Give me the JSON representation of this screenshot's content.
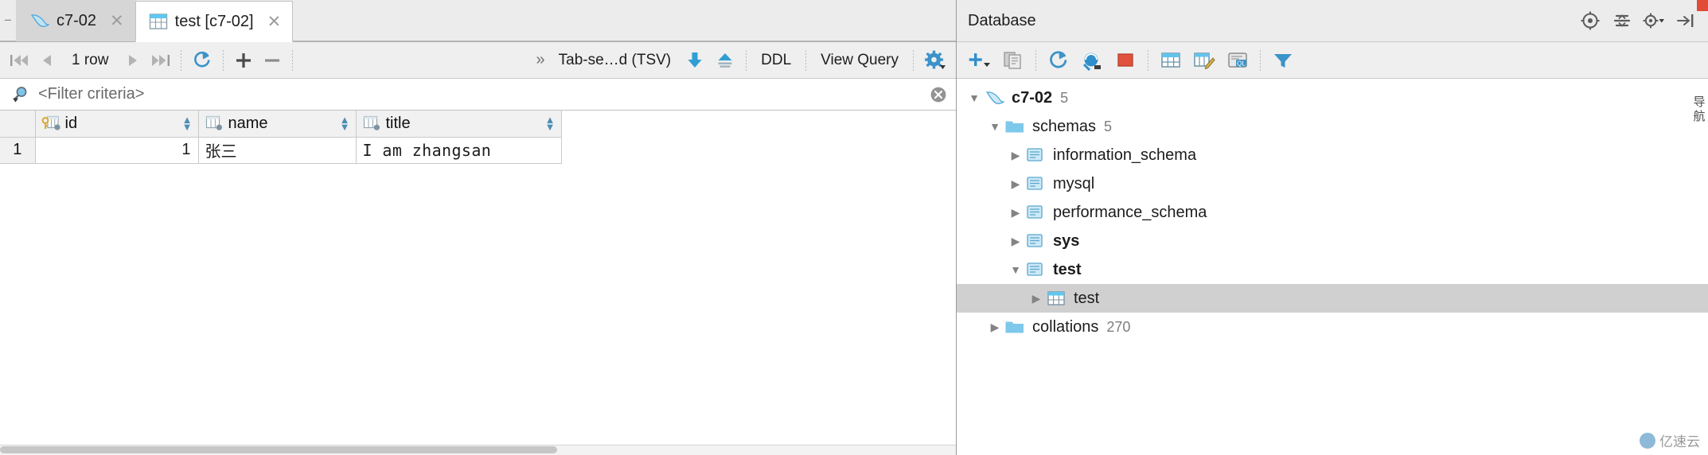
{
  "editor": {
    "tabs": [
      {
        "label": "c7-02",
        "icon": "dolphin-icon",
        "active": false,
        "closable": true
      },
      {
        "label": "test [c7-02]",
        "icon": "table-icon",
        "active": true,
        "closable": true
      }
    ]
  },
  "result_toolbar": {
    "first_page_icon": "first-page-icon",
    "prev_page_icon": "prev-page-icon",
    "row_count_label": "1 row",
    "next_page_icon": "next-page-icon",
    "last_page_icon": "last-page-icon",
    "reload_icon": "reload-icon",
    "add_row_icon": "plus-icon",
    "delete_row_icon": "minus-icon",
    "overflow_icon": "chevron-right-double-icon",
    "format_label": "Tab-se…d (TSV)",
    "import_icon": "download-icon",
    "export_icon": "upload-icon",
    "ddl_label": "DDL",
    "view_query_label": "View Query",
    "settings_icon": "gear-icon"
  },
  "filter": {
    "icon": "filter-search-icon",
    "placeholder": "<Filter criteria>",
    "value": "",
    "clear_icon": "clear-circle-icon"
  },
  "grid": {
    "columns": [
      {
        "name": "id",
        "icon": "primary-key-column-icon",
        "sortable": true
      },
      {
        "name": "name",
        "icon": "column-icon",
        "sortable": true
      },
      {
        "name": "title",
        "icon": "column-icon",
        "sortable": true
      }
    ],
    "rows": [
      {
        "num": "1",
        "id": "1",
        "name": "张三",
        "title": "I am zhangsan"
      }
    ]
  },
  "database_panel": {
    "title": "Database",
    "header_buttons": [
      {
        "icon": "jump-to-source-icon"
      },
      {
        "icon": "collapse-all-icon"
      },
      {
        "icon": "settings-dropdown-icon"
      },
      {
        "icon": "hide-panel-icon"
      }
    ],
    "toolbar_buttons": [
      {
        "icon": "add-data-source-icon"
      },
      {
        "icon": "copy-icon"
      },
      {
        "icon": "refresh-icon"
      },
      {
        "icon": "sync-icon"
      },
      {
        "icon": "stop-icon"
      },
      {
        "icon": "table-editor-icon"
      },
      {
        "icon": "modify-table-icon"
      },
      {
        "icon": "query-console-icon"
      },
      {
        "icon": "filter-icon"
      }
    ],
    "tree": [
      {
        "depth": 0,
        "label": "c7-02",
        "icon": "dolphin-icon",
        "count": "5",
        "expanded": true,
        "bold": true,
        "selected": false
      },
      {
        "depth": 1,
        "label": "schemas",
        "icon": "folder-icon",
        "count": "5",
        "expanded": true,
        "bold": false,
        "selected": false
      },
      {
        "depth": 2,
        "label": "information_schema",
        "icon": "schema-icon",
        "count": "",
        "expanded": false,
        "bold": false,
        "selected": false
      },
      {
        "depth": 2,
        "label": "mysql",
        "icon": "schema-icon",
        "count": "",
        "expanded": false,
        "bold": false,
        "selected": false
      },
      {
        "depth": 2,
        "label": "performance_schema",
        "icon": "schema-icon",
        "count": "",
        "expanded": false,
        "bold": false,
        "selected": false
      },
      {
        "depth": 2,
        "label": "sys",
        "icon": "schema-icon",
        "count": "",
        "expanded": false,
        "bold": true,
        "selected": false
      },
      {
        "depth": 2,
        "label": "test",
        "icon": "schema-icon",
        "count": "",
        "expanded": true,
        "bold": true,
        "selected": false
      },
      {
        "depth": 3,
        "label": "test",
        "icon": "table-icon",
        "count": "",
        "expanded": false,
        "bold": false,
        "selected": true
      },
      {
        "depth": 1,
        "label": "collations",
        "icon": "folder-icon",
        "count": "270",
        "expanded": false,
        "bold": false,
        "selected": false
      }
    ]
  },
  "right_rail": {
    "label": "导航"
  },
  "watermark": {
    "text": "亿速云"
  },
  "colors": {
    "accent": "#3b99d4",
    "selection": "#d0d0d0",
    "folder": "#7ec8eb",
    "alert": "#e24b37"
  }
}
